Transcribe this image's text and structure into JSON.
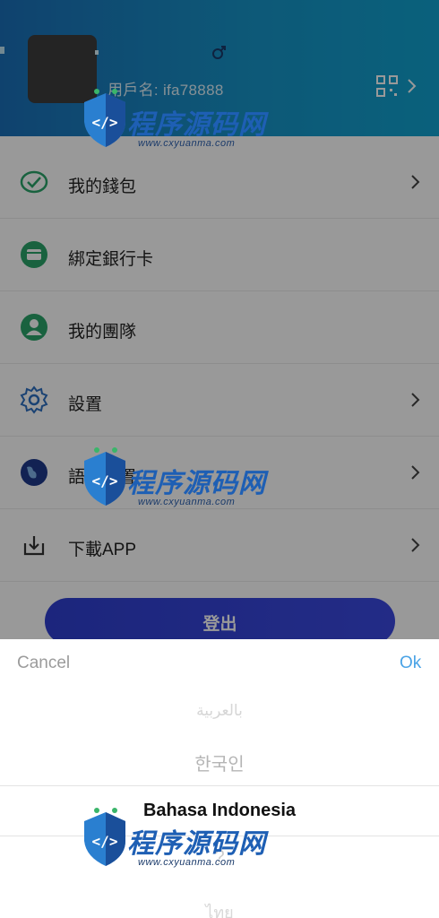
{
  "header": {
    "username_label": "用戶名: ifa78888",
    "gender_icon": "male-icon",
    "qr_icon": "qr-code-icon"
  },
  "menu": {
    "items": [
      {
        "label": "我的錢包",
        "icon": "wallet-icon",
        "has_chevron": true
      },
      {
        "label": "綁定銀行卡",
        "icon": "bank-card-icon",
        "has_chevron": false
      },
      {
        "label": "我的團隊",
        "icon": "team-icon",
        "has_chevron": false
      },
      {
        "label": "設置",
        "icon": "gear-icon",
        "has_chevron": true
      },
      {
        "label": "語言設置",
        "icon": "globe-icon",
        "has_chevron": true
      },
      {
        "label": "下載APP",
        "icon": "download-icon",
        "has_chevron": true
      }
    ],
    "logout_label": "登出"
  },
  "picker": {
    "cancel_label": "Cancel",
    "ok_label": "Ok",
    "options": [
      "بالعربية",
      "한국인",
      "Bahasa Indonesia",
      "?",
      "ไทย"
    ],
    "selected": "Bahasa Indonesia"
  },
  "watermark": {
    "brand": "程序源码网",
    "url": "www.cxyuanma.com"
  },
  "colors": {
    "header_start": "#1a6fb8",
    "header_end": "#11a2cf",
    "logout_button": "#3344d8",
    "ok_text": "#4aa3e6",
    "icon_green": "#2aa36a"
  }
}
